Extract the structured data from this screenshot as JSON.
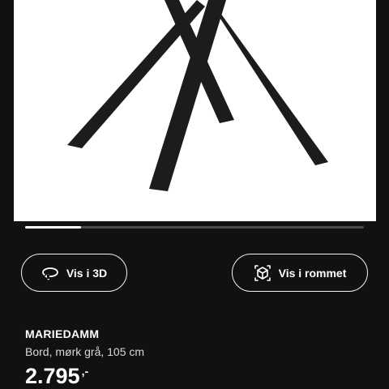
{
  "carousel": {
    "active_fraction": 0.165
  },
  "actions": {
    "view_3d": {
      "label": "Vis i 3D",
      "icon": "rotate-3d-icon"
    },
    "view_in_room": {
      "label": "Vis i rommet",
      "icon": "ar-cube-icon"
    }
  },
  "product": {
    "name": "MARIEDAMM",
    "description": "Bord, mørk grå, 105 cm",
    "price": "2.795",
    "price_suffix": ",-"
  },
  "colors": {
    "background": "#111111",
    "image_background": "#ffffff",
    "table_legs": "#1c1c1c",
    "text_primary": "#ffffff"
  }
}
